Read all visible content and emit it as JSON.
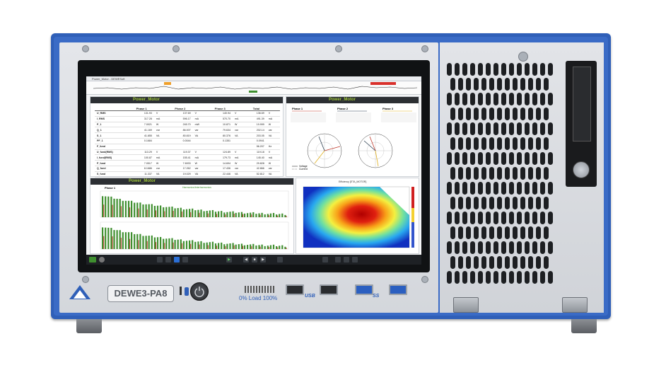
{
  "device": {
    "model": "DEWE3-PA8",
    "load_label": "0% Load 100%",
    "usb2_label": "USB",
    "usb3_label": "SS"
  },
  "screen": {
    "window_title": "Power_Motor - DEWESoft",
    "panel_top_title": "Power_Motor",
    "panel_phasor_title": "Power_Motor",
    "panel_bottom_title": "Power_Motor",
    "table": {
      "headers": [
        "",
        "Phase 1",
        "",
        "Phase 2",
        "",
        "Phase 3",
        "",
        "Total",
        ""
      ],
      "rows": [
        [
          "U_RMS",
          "131.93",
          "V",
          "137.69",
          "V",
          "140.94",
          "V",
          "136.69",
          "V"
        ],
        [
          "I_RMS",
          "317.28",
          "mA",
          "596.17",
          "mA",
          "570.70",
          "mA",
          "491.39",
          "mA"
        ],
        [
          "P_1",
          "7.0021",
          "W",
          "245.70",
          "mW",
          "10.871",
          "W",
          "19.999",
          "W"
        ],
        [
          "Q_1",
          "41.169",
          "var",
          "86.007",
          "var",
          "79.634",
          "var",
          "202.14",
          "var"
        ],
        [
          "S_1",
          "41.855",
          "VA",
          "80.819",
          "VA",
          "80.376",
          "VA",
          "203.05",
          "VA"
        ],
        [
          "PF_1",
          "0.1684",
          "",
          "0.0044",
          "",
          "0.1351",
          "",
          "0.0941",
          ""
        ],
        [
          "F_fund",
          "",
          "",
          "",
          "",
          "",
          "",
          "56.207",
          "Hz"
        ],
        [
          "U_fund(RMS)",
          "113.29",
          "V",
          "119.37",
          "V",
          "124.89",
          "V",
          "119.18",
          "V"
        ],
        [
          "I_fund(RMS)",
          "100.87",
          "mA",
          "155.41",
          "mA",
          "179.73",
          "mA",
          "145.40",
          "mA"
        ],
        [
          "P_fund",
          "7.0517",
          "W",
          "7.6933",
          "W",
          "14.694",
          "W",
          "29.828",
          "W"
        ],
        [
          "Q_fund",
          "8.1686",
          "var",
          "17.262",
          "var",
          "17.436",
          "var",
          "42.866",
          "var"
        ],
        [
          "S_fund",
          "11.337",
          "VA",
          "19.029",
          "VA",
          "22.446",
          "VA",
          "52.812",
          "VA"
        ]
      ]
    },
    "phasor_headers": [
      "Phase 1",
      "Phase 2",
      "Phase 3"
    ],
    "phasor_legend": [
      "Voltage",
      "Current"
    ],
    "harmonics": {
      "phase_label": "Phase 1",
      "chart_title": "Harmonics/Interharmonics",
      "ylabel_top": "Voltage (%)",
      "ylabel_bottom": "Current (%)"
    },
    "heatmap_title": "Efficiency [ETA_MOTOR]",
    "colors": {
      "accent": "#9ec43a",
      "bars": "#3f8f2f",
      "bars_alt": "#c0392b",
      "chassis": "#2f5fb8"
    }
  }
}
